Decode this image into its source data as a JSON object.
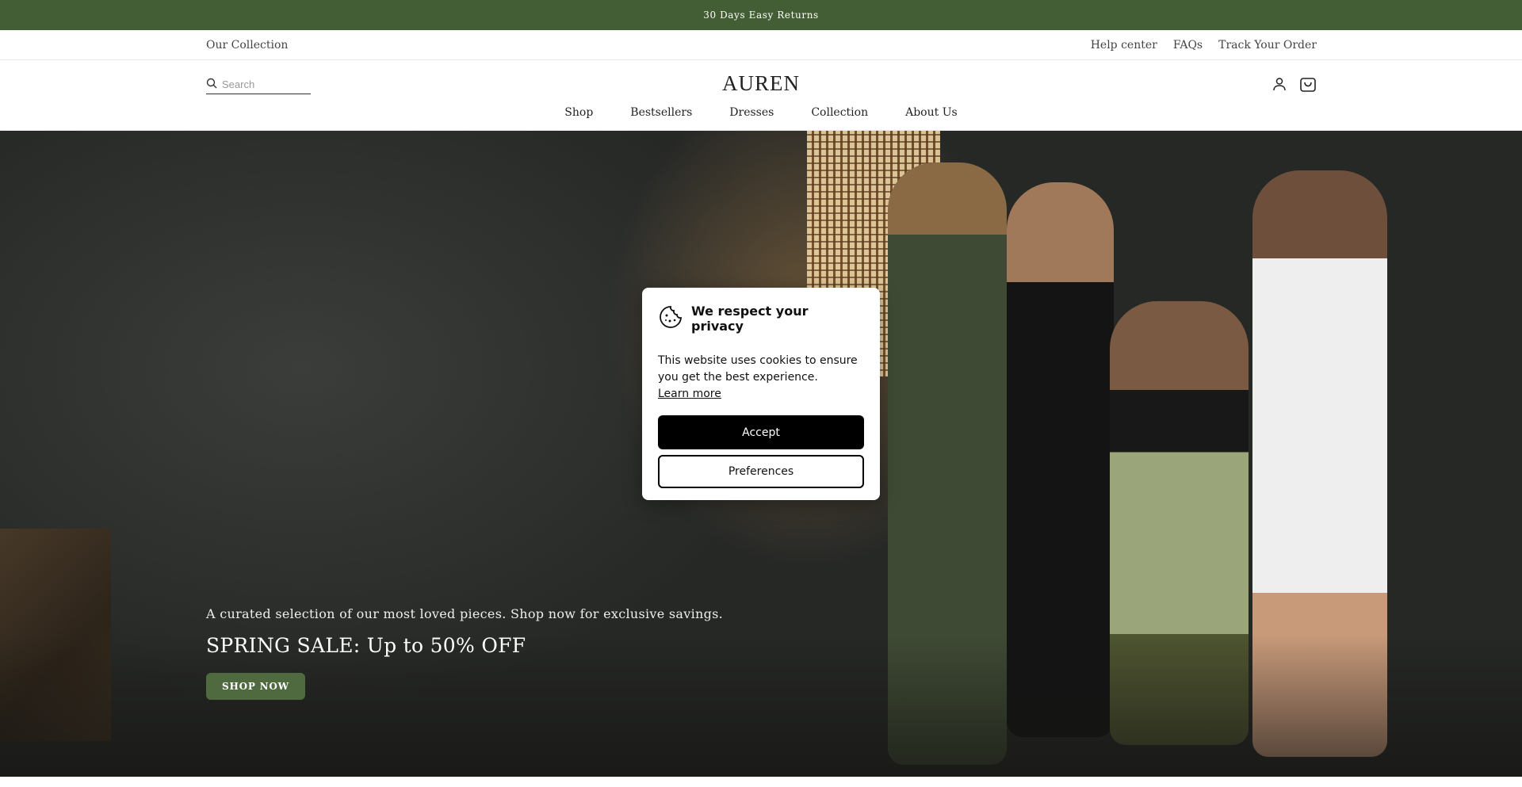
{
  "announcement": "30 Days Easy Returns",
  "utility_bar": {
    "left_link": "Our Collection",
    "right_links": [
      "Help center",
      "FAQs",
      "Track Your Order"
    ]
  },
  "header": {
    "search_placeholder": "Search",
    "logo": "AUREN",
    "nav": [
      "Shop",
      "Bestsellers",
      "Dresses",
      "Collection",
      "About Us"
    ]
  },
  "hero": {
    "subtitle": "A curated selection of our most loved pieces. Shop now for exclusive savings.",
    "title": "SPRING SALE: Up to 50% OFF",
    "cta": "SHOP NOW"
  },
  "cookie_modal": {
    "title": "We respect your privacy",
    "body": "This website uses cookies to ensure you get the best experience.",
    "learn_more": "Learn more",
    "accept": "Accept",
    "preferences": "Preferences"
  },
  "colors": {
    "announcement_bg": "#435e35",
    "cta_bg": "#4f6a3f",
    "accept_bg": "#000000"
  }
}
